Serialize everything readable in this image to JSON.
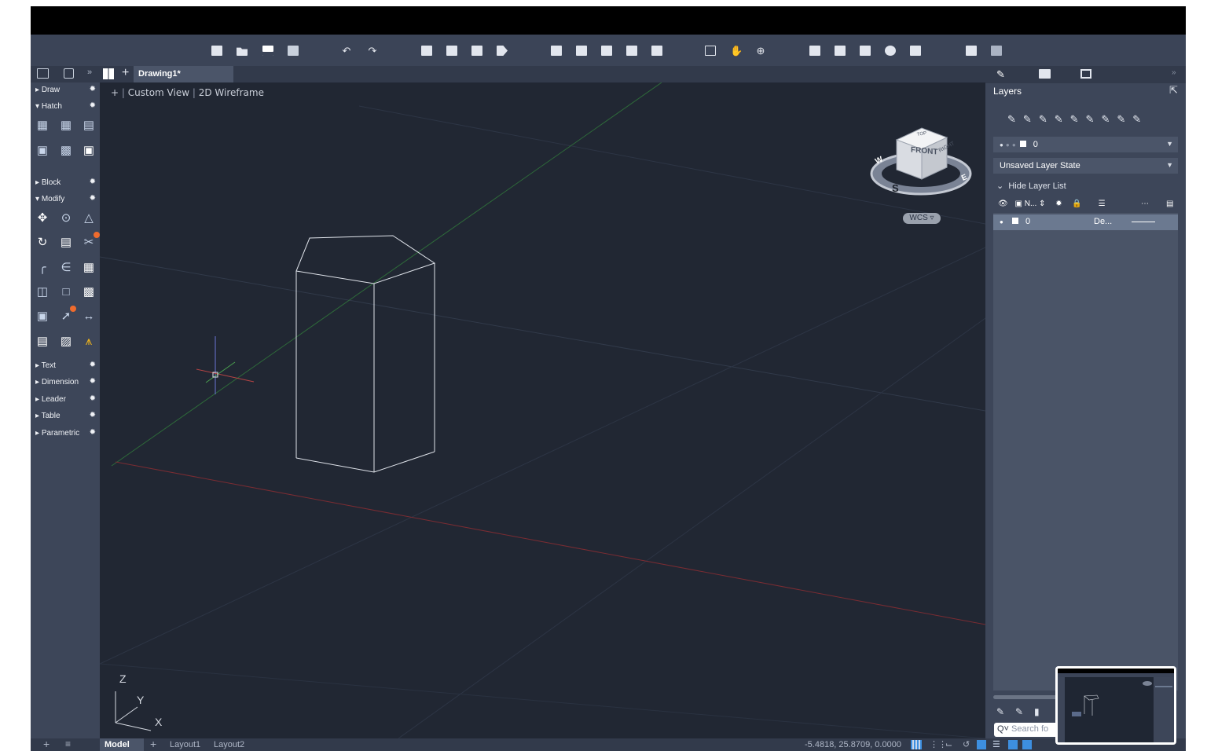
{
  "document": {
    "tab_title": "Drawing1*"
  },
  "left_panel": {
    "sections": [
      {
        "label": "Draw",
        "expanded": false
      },
      {
        "label": "Hatch",
        "expanded": true
      },
      {
        "label": "Block",
        "expanded": false
      },
      {
        "label": "Modify",
        "expanded": true
      },
      {
        "label": "Text",
        "expanded": false
      },
      {
        "label": "Dimension",
        "expanded": false
      },
      {
        "label": "Leader",
        "expanded": false
      },
      {
        "label": "Table",
        "expanded": false
      },
      {
        "label": "Parametric",
        "expanded": false
      }
    ]
  },
  "viewport": {
    "label_plus": "+",
    "label_view": "Custom View",
    "label_style": "2D Wireframe",
    "viewcube_front": "FRONT",
    "viewcube_right": "RIGHT",
    "viewcube_top": "TOP",
    "compass_w": "W",
    "compass_s": "S",
    "compass_e": "E",
    "wcs": "WCS",
    "ucs_x": "X",
    "ucs_y": "Y",
    "ucs_z": "Z"
  },
  "right_panel": {
    "title": "Layers",
    "current_layer": "0",
    "layer_state": "Unsaved Layer State",
    "hide_list_label": "Hide Layer List",
    "columns": {
      "name": "N...",
      "linetype_abbrev": "De..."
    },
    "layers": [
      {
        "name": "0",
        "linetype": "De..."
      }
    ],
    "search_placeholder": "Search fo"
  },
  "bottom_bar": {
    "tabs": [
      "Model",
      "Layout1",
      "Layout2"
    ],
    "coordinates": "-5.4818, 25.8709, 0.0000"
  }
}
